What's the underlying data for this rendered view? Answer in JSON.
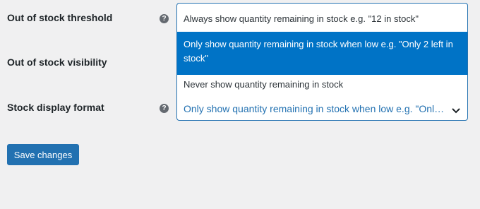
{
  "settings": {
    "rows": [
      {
        "label": "Out of stock threshold"
      },
      {
        "label": "Out of stock visibility"
      },
      {
        "label": "Stock display format"
      }
    ],
    "help_icon_glyph": "?"
  },
  "stock_format_select": {
    "selected_value": "Only show quantity remaining in stock when low e.g. \"Only 2 left in stock\"",
    "options": [
      {
        "label": "Always show quantity remaining in stock e.g. \"12 in stock\""
      },
      {
        "label": "Only show quantity remaining in stock when low e.g. \"Only 2 left in stock\"",
        "highlighted": true
      },
      {
        "label": "Never show quantity remaining in stock"
      }
    ]
  },
  "footer": {
    "save_label": "Save changes"
  },
  "colors": {
    "accent": "#2271b1",
    "highlight": "#0073c6",
    "background": "#f0f0f1"
  },
  "icons": {
    "help": "question-circle-icon",
    "dropdown": "chevron-down-icon"
  }
}
